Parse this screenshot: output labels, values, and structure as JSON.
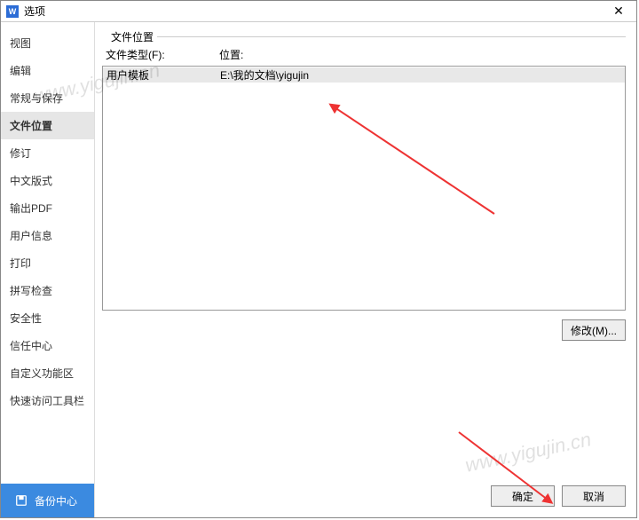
{
  "title": "选项",
  "sidebar": {
    "items": [
      {
        "label": "视图"
      },
      {
        "label": "编辑"
      },
      {
        "label": "常规与保存"
      },
      {
        "label": "文件位置"
      },
      {
        "label": "修订"
      },
      {
        "label": "中文版式"
      },
      {
        "label": "输出PDF"
      },
      {
        "label": "用户信息"
      },
      {
        "label": "打印"
      },
      {
        "label": "拼写检查"
      },
      {
        "label": "安全性"
      },
      {
        "label": "信任中心"
      },
      {
        "label": "自定义功能区"
      },
      {
        "label": "快速访问工具栏"
      }
    ],
    "active_index": 3,
    "backup_label": "备份中心"
  },
  "main": {
    "group_label": "文件位置",
    "header_type": "文件类型(F):",
    "header_location": "位置:",
    "rows": [
      {
        "type": "用户模板",
        "location": "E:\\我的文档\\yigujin"
      }
    ],
    "modify_label": "修改(M)..."
  },
  "footer": {
    "ok": "确定",
    "cancel": "取消"
  },
  "watermark": "www.yigujin.cn"
}
